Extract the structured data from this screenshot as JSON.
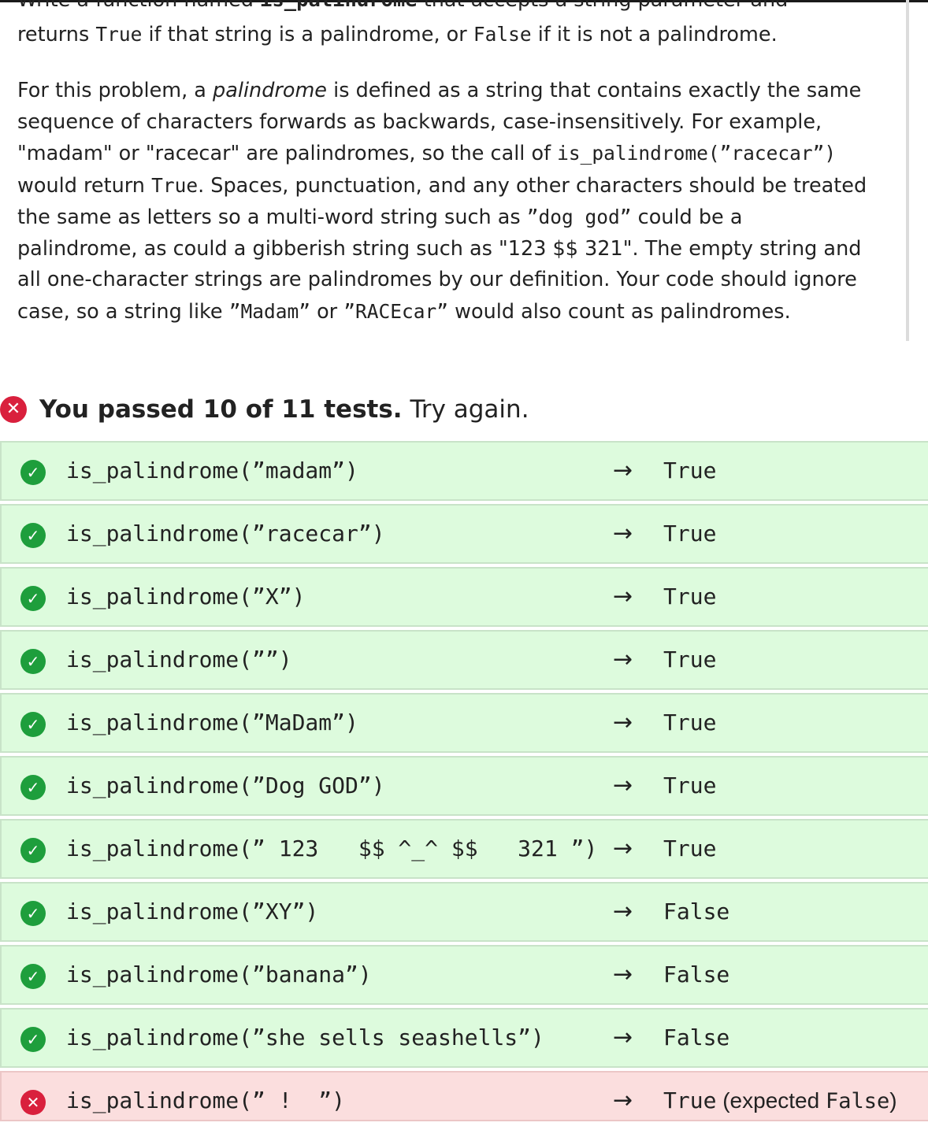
{
  "description": {
    "partial_line": {
      "pre": "Write a function named",
      "code": "is_palindrome",
      "post": "that accepts a string parameter and"
    },
    "line1": {
      "pre": "returns",
      "code_true": "True",
      "mid": "if that string is a palindrome, or",
      "code_false": "False",
      "post": "if it is not a palindrome."
    },
    "para2": {
      "l1_pre": "For this problem, a",
      "l1_em": "palindrome",
      "l1_post": "is defined as a string that contains exactly the same",
      "l2": "sequence of characters forwards as backwards, case-insensitively. For example,",
      "l3_pre": "\"madam\" or \"racecar\" are palindromes, so the call of",
      "l3_code": "is_palindrome(”racecar”)",
      "l4_pre": "would return",
      "l4_code": "True",
      "l4_post": ". Spaces, punctuation, and any other characters should be treated",
      "l5_pre": "the same as letters so a multi-word string such as",
      "l5_code": "”dog god”",
      "l5_post": "could be a",
      "l6": "palindrome, as could a gibberish string such as \"123 $$ 321\". The empty string and",
      "l7": "all one-character strings are palindromes by our definition. Your code should ignore",
      "l8_pre": "case, so a string like",
      "l8_code1": "”Madam”",
      "l8_mid": "or",
      "l8_code2": "”RACEcar”",
      "l8_post": "would also count as palindromes."
    }
  },
  "summary": {
    "strong_text": "You passed 10 of 11 tests.",
    "rest_text": "Try again."
  },
  "tests": [
    {
      "call": "is_palindrome(”madam”)",
      "arrow": "→",
      "result": "True",
      "status": "pass"
    },
    {
      "call": "is_palindrome(”racecar”)",
      "arrow": "→",
      "result": "True",
      "status": "pass"
    },
    {
      "call": "is_palindrome(”X”)",
      "arrow": "→",
      "result": "True",
      "status": "pass"
    },
    {
      "call": "is_palindrome(””)",
      "arrow": "→",
      "result": "True",
      "status": "pass"
    },
    {
      "call": "is_palindrome(”MaDam”)",
      "arrow": "→",
      "result": "True",
      "status": "pass"
    },
    {
      "call": "is_palindrome(”Dog GOD”)",
      "arrow": "→",
      "result": "True",
      "status": "pass"
    },
    {
      "call": "is_palindrome(” 123   $$ ^_^ $$   321 ”)",
      "arrow": "→",
      "result": "True",
      "status": "pass"
    },
    {
      "call": "is_palindrome(”XY”)",
      "arrow": "→",
      "result": "False",
      "status": "pass"
    },
    {
      "call": "is_palindrome(”banana”)",
      "arrow": "→",
      "result": "False",
      "status": "pass"
    },
    {
      "call": "is_palindrome(”she sells seashells”)",
      "arrow": "→",
      "result": "False",
      "status": "pass"
    },
    {
      "call": "is_palindrome(” !  ”)",
      "arrow": "→",
      "result": "True",
      "expected_pre": "(expected",
      "expected_value": "False",
      "expected_post": ")",
      "status": "fail"
    }
  ],
  "colors": {
    "pass_bg": "#ddfbdd",
    "fail_bg": "#fbdede",
    "pass_icon": "#1e9e3c",
    "fail_icon": "#d9203d"
  },
  "icons": {
    "pass": "check-circle-icon",
    "fail": "x-circle-icon"
  }
}
